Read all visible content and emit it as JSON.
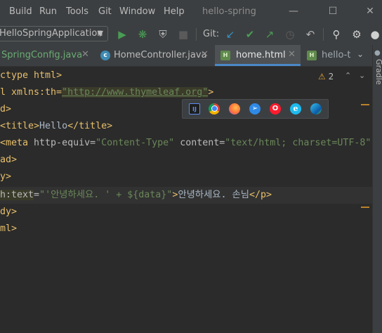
{
  "menu": {
    "items": [
      {
        "label": "Build"
      },
      {
        "label": "Run"
      },
      {
        "label": "Tools"
      },
      {
        "label": "Git"
      },
      {
        "label": "Window"
      },
      {
        "label": "Help"
      }
    ],
    "project_title": "hello-spring"
  },
  "toolbar": {
    "run_config": "HelloSpringApplication",
    "git_label": "Git:",
    "icons": [
      "run-icon",
      "debug-icon",
      "coverage-icon",
      "stop-icon",
      "git-update-icon",
      "git-commit-icon",
      "git-push-icon",
      "history-icon",
      "rollback-icon",
      "search-icon",
      "settings-icon",
      "more-icon"
    ]
  },
  "tabs": [
    {
      "label": "SpringConfig.java",
      "icon": "java-class-icon",
      "active": false
    },
    {
      "label": "HomeController.java",
      "icon": "java-class-icon",
      "active": false
    },
    {
      "label": "home.html",
      "icon": "html-file-icon",
      "active": true
    },
    {
      "label": "hello-t",
      "icon": "html-file-icon",
      "active": false
    }
  ],
  "sidebar": {
    "gradle_label": "Gradle"
  },
  "inspections": {
    "warning_count": "2"
  },
  "browsers": [
    "intellij-icon",
    "chrome-icon",
    "firefox-icon",
    "safari-icon",
    "opera-icon",
    "ie-icon",
    "edge-icon"
  ],
  "code": {
    "l1": {
      "a": "ctype html",
      "b": ">"
    },
    "l2": {
      "a": "l xmlns:th=",
      "url": "\"http://www.thymeleaf.org\"",
      "b": ">"
    },
    "l3": {
      "a": "d>"
    },
    "l4": {
      "open": "<title>",
      "text": "Hello",
      "close": "</title>"
    },
    "l5": {
      "open": "<meta",
      "attr1": " http-equiv=",
      "val1": "\"Content-Type\"",
      "attr2": " content=",
      "val2": "\"text/html; charset=UTF-8\""
    },
    "l6": {
      "a": "ad>"
    },
    "l7": {
      "a": "y>"
    },
    "l8": {
      "th": "h:text",
      "eq": "=",
      "val": "\"'안녕하세요. ' + ${data}\"",
      "gt": ">",
      "text": "안녕하세요. 손님",
      "close": "</p>"
    },
    "l9": {
      "a": "dy>"
    },
    "l10": {
      "a": "ml>"
    }
  }
}
